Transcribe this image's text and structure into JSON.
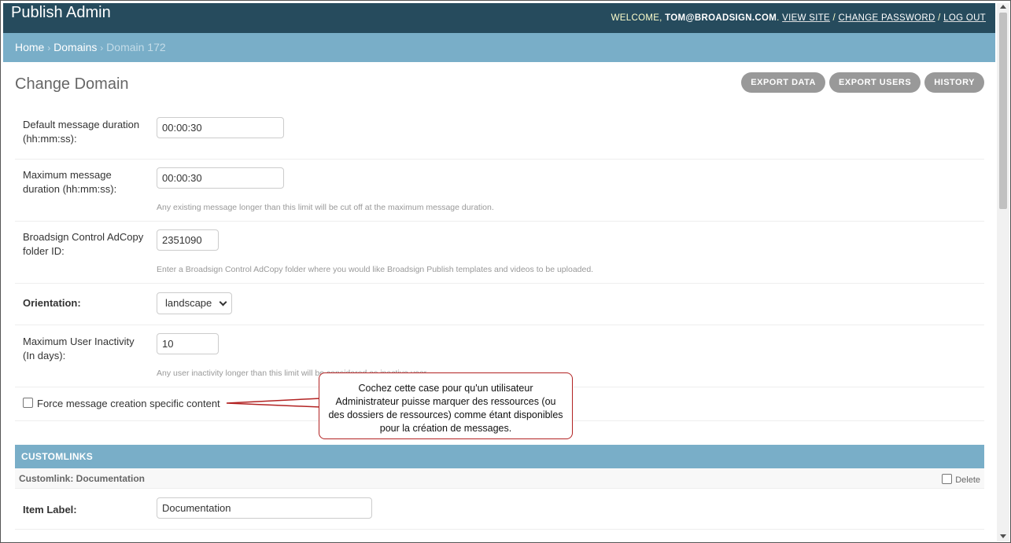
{
  "header": {
    "brand": "Publish Admin",
    "welcome": "WELCOME,",
    "user": "TOM@BROADSIGN.COM",
    "view_site": "VIEW SITE",
    "change_password": "CHANGE PASSWORD",
    "log_out": "LOG OUT",
    "sep": "/"
  },
  "breadcrumbs": {
    "home": "Home",
    "domains": "Domains",
    "current": "Domain 172",
    "sep": "›"
  },
  "page": {
    "title": "Change Domain",
    "tools": {
      "export_data": "EXPORT DATA",
      "export_users": "EXPORT USERS",
      "history": "HISTORY"
    }
  },
  "fields": {
    "default_duration": {
      "label": "Default message duration (hh:mm:ss):",
      "value": "00:00:30"
    },
    "max_duration": {
      "label": "Maximum message duration (hh:mm:ss):",
      "value": "00:00:30",
      "help": "Any existing message longer than this limit will be cut off at the maximum message duration."
    },
    "adcopy_folder": {
      "label": "Broadsign Control AdCopy folder ID:",
      "value": "2351090",
      "help": "Enter a Broadsign Control AdCopy folder where you would like Broadsign Publish templates and videos to be uploaded."
    },
    "orientation": {
      "label": "Orientation:",
      "value": "landscape"
    },
    "max_inactivity": {
      "label": "Maximum User Inactivity (In days):",
      "value": "10",
      "help": "Any user inactivity longer than this limit will be considered as inactive user."
    },
    "force_content": {
      "label": "Force message creation specific content",
      "checked": false
    }
  },
  "customlinks": {
    "caption": "CUSTOMLINKS",
    "inline_title": "Customlink: Documentation",
    "delete_label": "Delete",
    "item_label": {
      "label": "Item Label:",
      "value": "Documentation"
    }
  },
  "callout": {
    "text": "Cochez cette case pour qu'un utilisateur Administrateur puisse marquer des ressources (ou des dossiers de ressources) comme étant disponibles pour la création de messages."
  },
  "colors": {
    "header_bg": "#264b5d",
    "breadcrumb_bg": "#79aec8",
    "tool_bg": "#999999",
    "callout_border": "#b22222"
  }
}
